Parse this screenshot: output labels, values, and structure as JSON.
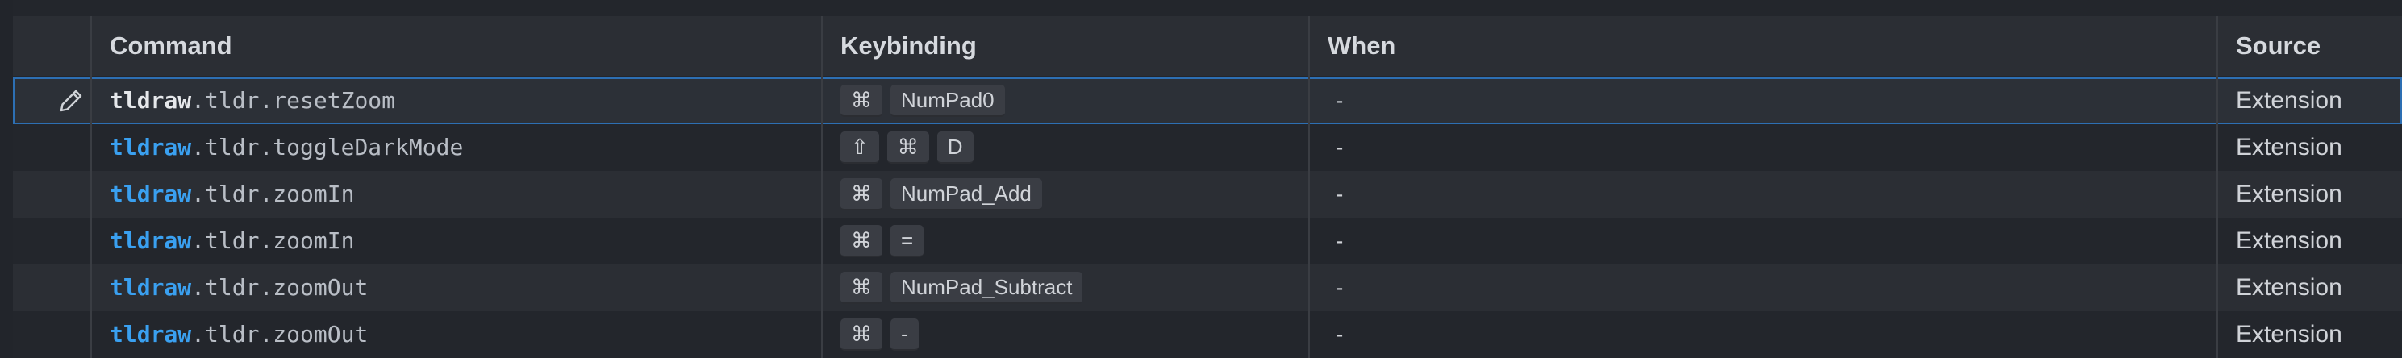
{
  "headers": {
    "command": "Command",
    "keybinding": "Keybinding",
    "when": "When",
    "source": "Source"
  },
  "rows": [
    {
      "ext": "tldraw",
      "rest": ".tldr.resetZoom",
      "keys": [
        "⌘",
        "NumPad0"
      ],
      "when": "-",
      "source": "Extension",
      "selected": true
    },
    {
      "ext": "tldraw",
      "rest": ".tldr.toggleDarkMode",
      "keys": [
        "⇧",
        "⌘",
        "D"
      ],
      "when": "-",
      "source": "Extension"
    },
    {
      "ext": "tldraw",
      "rest": ".tldr.zoomIn",
      "keys": [
        "⌘",
        "NumPad_Add"
      ],
      "when": "-",
      "source": "Extension"
    },
    {
      "ext": "tldraw",
      "rest": ".tldr.zoomIn",
      "keys": [
        "⌘",
        "="
      ],
      "when": "-",
      "source": "Extension"
    },
    {
      "ext": "tldraw",
      "rest": ".tldr.zoomOut",
      "keys": [
        "⌘",
        "NumPad_Subtract"
      ],
      "when": "-",
      "source": "Extension"
    },
    {
      "ext": "tldraw",
      "rest": ".tldr.zoomOut",
      "keys": [
        "⌘",
        "-"
      ],
      "when": "-",
      "source": "Extension"
    }
  ],
  "icons": {
    "edit": "pencil-icon"
  },
  "colors": {
    "accent": "#3aa0f0",
    "selection_border": "#2d6fb3"
  }
}
